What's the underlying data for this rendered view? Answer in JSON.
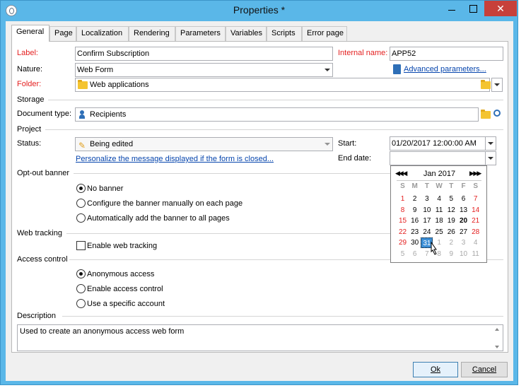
{
  "window": {
    "title": "Properties *",
    "close_glyph": "✕"
  },
  "tabs": [
    {
      "label": "General"
    },
    {
      "label": "Page"
    },
    {
      "label": "Localization"
    },
    {
      "label": "Rendering"
    },
    {
      "label": "Parameters"
    },
    {
      "label": "Variables"
    },
    {
      "label": "Scripts"
    },
    {
      "label": "Error page"
    }
  ],
  "form": {
    "label_label": "Label:",
    "label_value": "Confirm Subscription",
    "internal_name_label": "Internal name:",
    "internal_name_value": "APP52",
    "nature_label": "Nature:",
    "nature_value": "Web Form",
    "advanced_link": "Advanced parameters...",
    "folder_label": "Folder:",
    "folder_value": "Web applications",
    "storage_section": "Storage",
    "document_type_label": "Document type:",
    "document_type_value": "Recipients",
    "project_section": "Project",
    "status_label": "Status:",
    "status_value": "Being edited",
    "start_label": "Start:",
    "start_value": "01/20/2017 12:00:00 AM",
    "end_date_label": "End date:",
    "end_date_value": "",
    "personalize_link": "Personalize the message displayed if the form is closed...",
    "optout_section": "Opt-out banner",
    "optout_options": [
      "No banner",
      "Configure the banner manually on each page",
      "Automatically add the banner to all pages"
    ],
    "optout_selected": 0,
    "web_tracking_section": "Web tracking",
    "web_tracking_label": "Enable web tracking",
    "web_tracking_checked": false,
    "access_section": "Access control",
    "access_options": [
      "Anonymous access",
      "Enable access control",
      "Use a specific account"
    ],
    "access_selected": 0,
    "description_section": "Description",
    "description_value": "Used to create an anonymous access web form"
  },
  "calendar": {
    "month_label": "Jan 2017",
    "nav_prev": "◀◀ ◀",
    "nav_next": "▶ ▶▶",
    "weekdays": [
      "S",
      "M",
      "T",
      "W",
      "T",
      "F",
      "S"
    ],
    "weeks": [
      [
        "1",
        "2",
        "3",
        "4",
        "5",
        "6",
        "7"
      ],
      [
        "8",
        "9",
        "10",
        "11",
        "12",
        "13",
        "14"
      ],
      [
        "15",
        "16",
        "17",
        "18",
        "19",
        "20",
        "21"
      ],
      [
        "22",
        "23",
        "24",
        "25",
        "26",
        "27",
        "28"
      ],
      [
        "29",
        "30",
        "31",
        "1",
        "2",
        "3",
        "4"
      ],
      [
        "5",
        "6",
        "7",
        "8",
        "9",
        "10",
        "11"
      ]
    ],
    "selected_day": "31",
    "bold_day": "20"
  },
  "buttons": {
    "ok": "Ok",
    "cancel": "Cancel"
  },
  "colors": {
    "titlebar": "#5ab7e8",
    "required_label": "#e42020",
    "link": "#0645ad",
    "selection": "#3d8fd6",
    "close": "#c7403a"
  }
}
